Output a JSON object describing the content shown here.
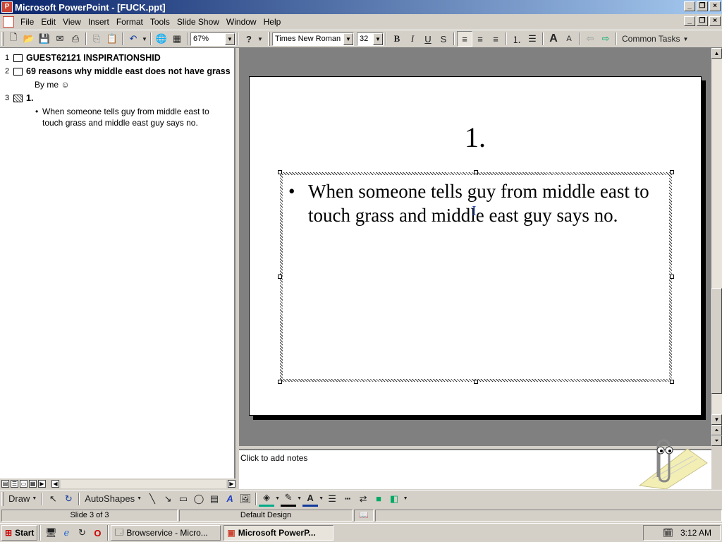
{
  "window": {
    "title": "Microsoft PowerPoint - [FUCK.ppt]"
  },
  "menu": [
    "File",
    "Edit",
    "View",
    "Insert",
    "Format",
    "Tools",
    "Slide Show",
    "Window",
    "Help"
  ],
  "toolbar": {
    "zoom": "67%",
    "font": "Times New Roman",
    "size": "32",
    "common_tasks": "Common Tasks"
  },
  "outline": {
    "slides": [
      {
        "num": "1",
        "title": "GUEST62121 INSPIRATIONSHID",
        "sub": []
      },
      {
        "num": "2",
        "title": "69 reasons why middle east does not have grass",
        "sub": [
          "By me ☺"
        ]
      },
      {
        "num": "3",
        "title": "1.",
        "sub": [
          "When someone tells guy from middle east to touch grass and middle east guy says no."
        ]
      }
    ]
  },
  "slide": {
    "title": "1.",
    "bullet": "When someone tells guy from middle east to touch grass and middle east guy says no."
  },
  "notes": {
    "placeholder": "Click to add notes"
  },
  "drawing": {
    "draw": "Draw",
    "autoshapes": "AutoShapes"
  },
  "status": {
    "slide": "Slide 3 of 3",
    "design": "Default Design"
  },
  "taskbar": {
    "start": "Start",
    "task1": "Browservice - Micro...",
    "task2": "Microsoft PowerP...",
    "clock": "3:12 AM"
  },
  "colors": {
    "title_start": "#0a246a",
    "title_end": "#a6caf0",
    "face": "#d4d0c8"
  }
}
